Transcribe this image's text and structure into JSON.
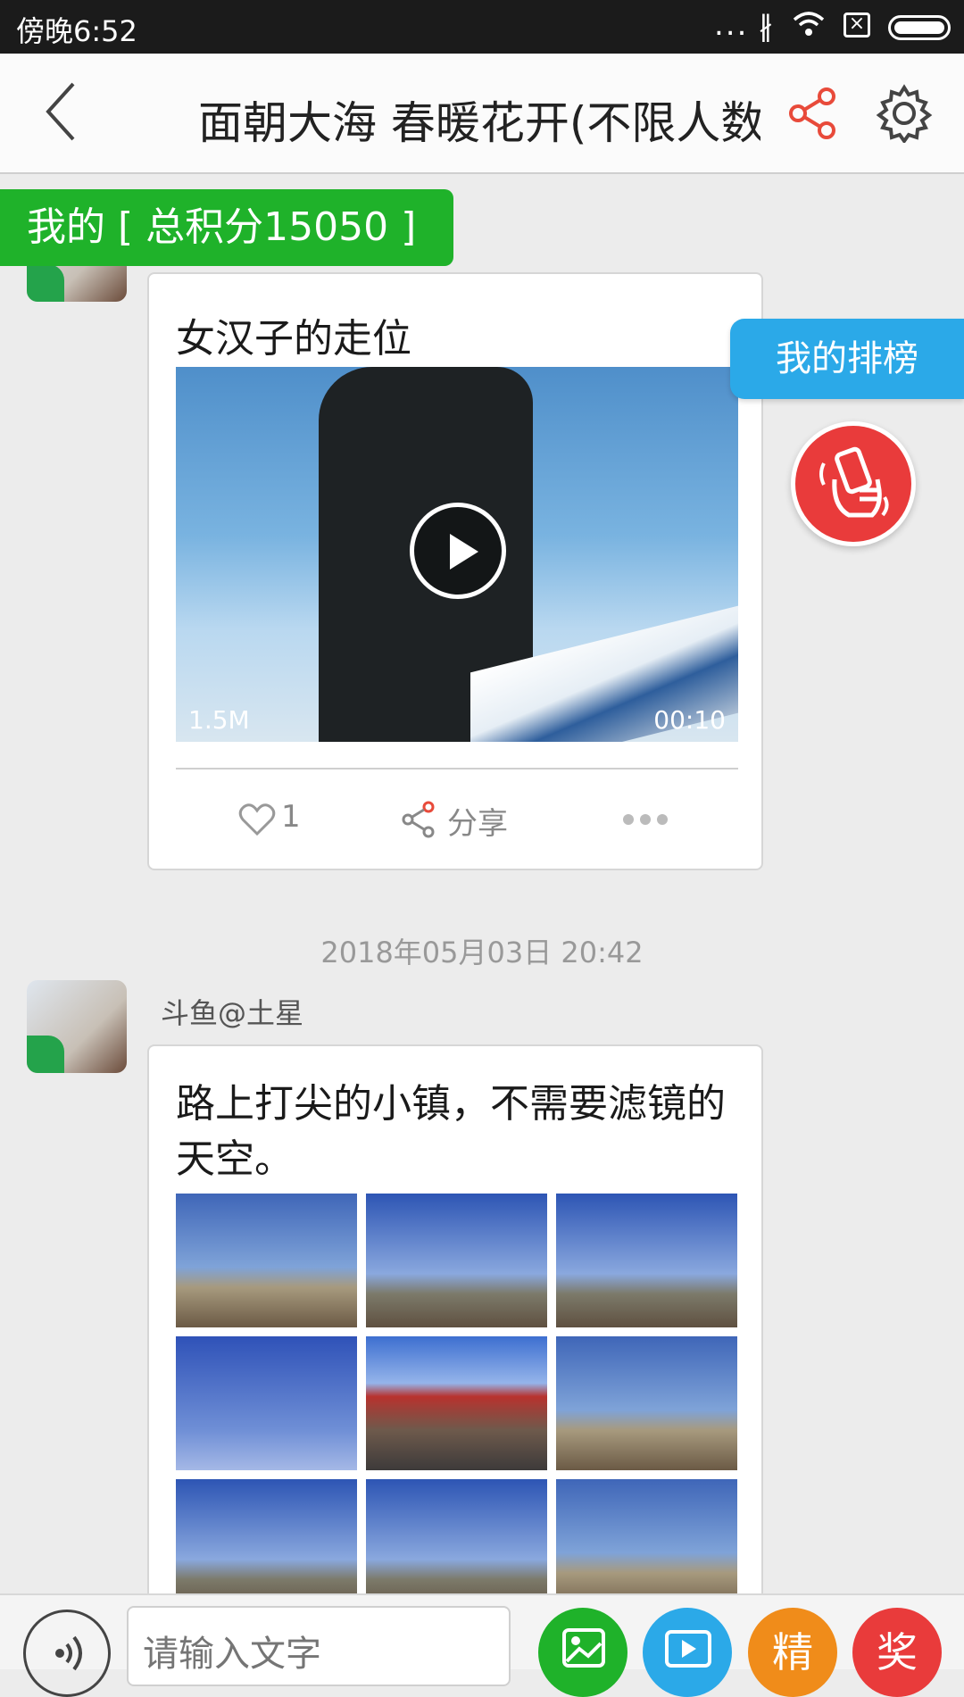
{
  "status_bar": {
    "time": "傍晚6:52",
    "more": "...",
    "bluetooth": "∦"
  },
  "header": {
    "title": "面朝大海 春暖花开(不限人数)"
  },
  "score_tab": {
    "label": "我的 [ 总积分15050 ]"
  },
  "rank_button": {
    "label": "我的排榜"
  },
  "posts": [
    {
      "title": "女汉子的走位",
      "video": {
        "size": "1.5M",
        "duration": "00:10"
      },
      "actions": {
        "like_count": "1",
        "share_label": "分享"
      }
    },
    {
      "timestamp": "2018年05月03日 20:42",
      "username": "斗鱼@土星",
      "text": "路上打尖的小镇，不需要滤镜的天空。"
    }
  ],
  "bottom_bar": {
    "input_placeholder": "请输入文字",
    "featured_label": "精",
    "reward_label": "奖"
  },
  "colors": {
    "green": "#1fb22a",
    "blue": "#2ba9e8",
    "red": "#e93b3b",
    "orange": "#f08c1a"
  }
}
